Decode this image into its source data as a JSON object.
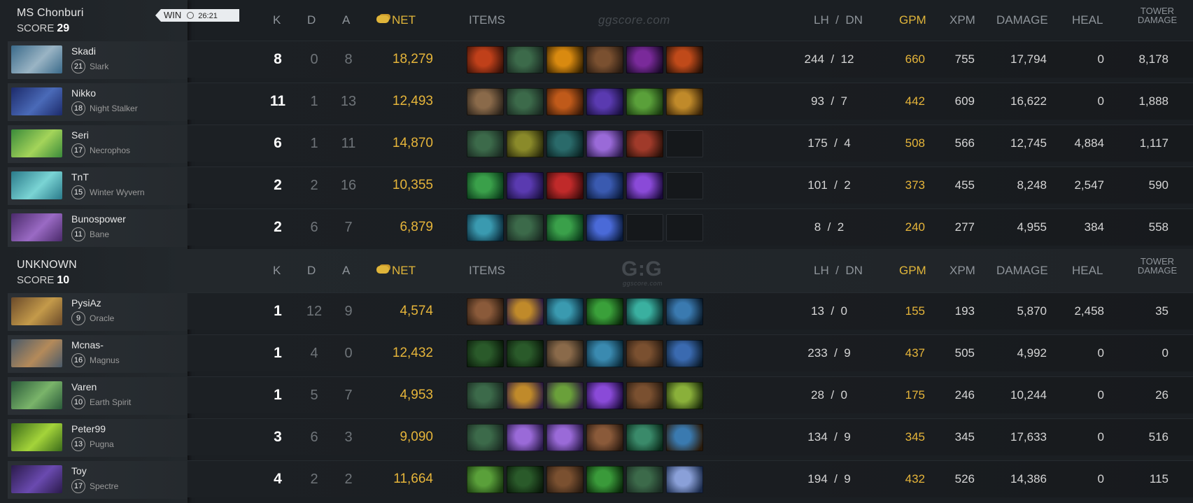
{
  "match": {
    "result": "WIN",
    "duration": "26:21"
  },
  "columns": {
    "k": "K",
    "d": "D",
    "a": "A",
    "net": "NET",
    "items": "ITEMS",
    "lh_dn": "LH  /  DN",
    "gpm": "GPM",
    "xpm": "XPM",
    "damage": "DAMAGE",
    "heal": "HEAL",
    "tower_1": "TOWER",
    "tower_2": "DAMAGE"
  },
  "watermarks": {
    "top": "ggscore.com",
    "logo": "G:G",
    "sub": "ggscore.com"
  },
  "teams": [
    {
      "name": "MS Chonburi",
      "score_label": "SCORE",
      "score": "29",
      "players": [
        {
          "name": "Skadi",
          "level": "21",
          "hero": "Slark",
          "k": "8",
          "d": "0",
          "a": "8",
          "net": "18,279",
          "lh": "244  /  12",
          "gpm": "660",
          "xpm": "755",
          "damage": "17,794",
          "heal": "0",
          "tower": "8,178",
          "portrait": [
            "#3a6a8a",
            "#9ab4c4"
          ],
          "items": [
            [
              "#c0401a",
              "#3a1208"
            ],
            [
              "#3c6a4a",
              "#1a2a22"
            ],
            [
              "#d98a10",
              "#3a2400"
            ],
            [
              "#7a5030",
              "#2a1c12"
            ],
            [
              "#7a2a9a",
              "#1a0a2a"
            ],
            [
              "#c04a1a",
              "#2a1206"
            ]
          ]
        },
        {
          "name": "Nikko",
          "level": "18",
          "hero": "Night Stalker",
          "k": "11",
          "d": "1",
          "a": "13",
          "net": "12,493",
          "lh": "93  /  7",
          "gpm": "442",
          "xpm": "609",
          "damage": "16,622",
          "heal": "0",
          "tower": "1,888",
          "portrait": [
            "#1c2a6a",
            "#4a6ab8"
          ],
          "items": [
            [
              "#8a6a4a",
              "#2a221a"
            ],
            [
              "#3c6a4a",
              "#1a2a22"
            ],
            [
              "#c05a1a",
              "#3a1a08"
            ],
            [
              "#5a3ab0",
              "#1a1040"
            ],
            [
              "#5aa03a",
              "#1a3a10"
            ],
            [
              "#c08a2a",
              "#3a2408"
            ]
          ]
        },
        {
          "name": "Seri",
          "level": "17",
          "hero": "Necrophos",
          "k": "6",
          "d": "1",
          "a": "11",
          "net": "14,870",
          "lh": "175  /  4",
          "gpm": "508",
          "xpm": "566",
          "damage": "12,745",
          "heal": "4,884",
          "tower": "1,117",
          "portrait": [
            "#3a8a3a",
            "#a4d45a"
          ],
          "items": [
            [
              "#3c6a4a",
              "#1a2a22"
            ],
            [
              "#8a8a2a",
              "#2a2a0a"
            ],
            [
              "#2a6a6a",
              "#0a2222"
            ],
            [
              "#9a6ad8",
              "#2a1a4a"
            ],
            [
              "#a03a2a",
              "#2a1008"
            ],
            null
          ]
        },
        {
          "name": "TnT",
          "level": "15",
          "hero": "Winter Wyvern",
          "k": "2",
          "d": "2",
          "a": "16",
          "net": "10,355",
          "lh": "101  /  2",
          "gpm": "373",
          "xpm": "455",
          "damage": "8,248",
          "heal": "2,547",
          "tower": "590",
          "portrait": [
            "#2a7a8a",
            "#7ad4d4"
          ],
          "items": [
            [
              "#3aa04a",
              "#0a3a1a"
            ],
            [
              "#5a3ab0",
              "#1a1040"
            ],
            [
              "#c02a2a",
              "#3a0a0a"
            ],
            [
              "#3a5ab0",
              "#0a1a3a"
            ],
            [
              "#8a4ad8",
              "#1a0a3a"
            ],
            null
          ]
        },
        {
          "name": "Bunospower",
          "level": "11",
          "hero": "Bane",
          "k": "2",
          "d": "6",
          "a": "7",
          "net": "6,879",
          "lh": "8  /  2",
          "gpm": "240",
          "xpm": "277",
          "damage": "4,955",
          "heal": "384",
          "tower": "558",
          "portrait": [
            "#4a2a6a",
            "#9a6ac4"
          ],
          "items": [
            [
              "#3a9ab0",
              "#0a2a3a"
            ],
            [
              "#3c6a4a",
              "#1a2a22"
            ],
            [
              "#3aa04a",
              "#0a3a1a"
            ],
            [
              "#4a6ad8",
              "#0a1a3a"
            ],
            null,
            null
          ]
        }
      ]
    },
    {
      "name": "UNKNOWN",
      "score_label": "SCORE",
      "score": "10",
      "players": [
        {
          "name": "PysiAz",
          "level": "9",
          "hero": "Oracle",
          "k": "1",
          "d": "12",
          "a": "9",
          "net": "4,574",
          "lh": "13  /  0",
          "gpm": "155",
          "xpm": "193",
          "damage": "5,870",
          "heal": "2,458",
          "tower": "35",
          "portrait": [
            "#6a4a2a",
            "#c49a4a"
          ],
          "items": [
            [
              "#8a5a3a",
              "#2a1a10"
            ],
            [
              "#c08a2a",
              "#2a1a40"
            ],
            [
              "#3a9ab0",
              "#0a2a3a"
            ],
            [
              "#3aa03a",
              "#0a2a0a"
            ],
            [
              "#3ab0a0",
              "#0a2a2a"
            ],
            [
              "#3a7ab0",
              "#0a1a2a"
            ]
          ]
        },
        {
          "name": "Mcnas-",
          "level": "16",
          "hero": "Magnus",
          "k": "1",
          "d": "4",
          "a": "0",
          "net": "12,432",
          "lh": "233  /  9",
          "gpm": "437",
          "xpm": "505",
          "damage": "4,992",
          "heal": "0",
          "tower": "0",
          "portrait": [
            "#4a5a6a",
            "#b48a5a"
          ],
          "items": [
            [
              "#2a5a2a",
              "#0a1a0a"
            ],
            [
              "#2a5a2a",
              "#0a1a0a"
            ],
            [
              "#8a6a4a",
              "#2a221a"
            ],
            [
              "#3a8ab0",
              "#0a2a3a"
            ],
            [
              "#7a5030",
              "#2a1c12"
            ],
            [
              "#3a6ab0",
              "#0a1a2a"
            ]
          ]
        },
        {
          "name": "Varen",
          "level": "10",
          "hero": "Earth Spirit",
          "k": "1",
          "d": "5",
          "a": "7",
          "net": "4,953",
          "lh": "28  /  0",
          "gpm": "175",
          "xpm": "246",
          "damage": "10,244",
          "heal": "0",
          "tower": "26",
          "portrait": [
            "#2a5a3a",
            "#7ab46a"
          ],
          "items": [
            [
              "#3c6a4a",
              "#1a2a22"
            ],
            [
              "#c08a2a",
              "#2a1a40"
            ],
            [
              "#6aa03a",
              "#2a1a3a"
            ],
            [
              "#8a4ad8",
              "#1a0a3a"
            ],
            [
              "#7a5030",
              "#2a1c12"
            ],
            [
              "#8ab03a",
              "#1a2a0a"
            ]
          ]
        },
        {
          "name": "Peter99",
          "level": "13",
          "hero": "Pugna",
          "k": "3",
          "d": "6",
          "a": "3",
          "net": "9,090",
          "lh": "134  /  9",
          "gpm": "345",
          "xpm": "345",
          "damage": "17,633",
          "heal": "0",
          "tower": "516",
          "portrait": [
            "#3a6a1a",
            "#a4d43a"
          ],
          "items": [
            [
              "#3c6a4a",
              "#1a2a22"
            ],
            [
              "#9a6ad8",
              "#2a1a4a"
            ],
            [
              "#9a6ad8",
              "#2a1a4a"
            ],
            [
              "#8a5a3a",
              "#2a1a10"
            ],
            [
              "#3a8a6a",
              "#0a2a1a"
            ],
            [
              "#3a7ab0",
              "#2a1a0a"
            ]
          ]
        },
        {
          "name": "Toy",
          "level": "17",
          "hero": "Spectre",
          "k": "4",
          "d": "2",
          "a": "2",
          "net": "11,664",
          "lh": "194  /  9",
          "gpm": "432",
          "xpm": "526",
          "damage": "14,386",
          "heal": "0",
          "tower": "115",
          "portrait": [
            "#2a1a4a",
            "#6a4ab0"
          ],
          "items": [
            [
              "#5aa03a",
              "#1a3a10"
            ],
            [
              "#2a5a2a",
              "#0a1a0a"
            ],
            [
              "#7a5030",
              "#2a1c12"
            ],
            [
              "#3a9a3a",
              "#0a2a0a"
            ],
            [
              "#3c6a4a",
              "#1a2a22"
            ],
            [
              "#8aa0d8",
              "#1a2a4a"
            ]
          ]
        }
      ]
    }
  ]
}
